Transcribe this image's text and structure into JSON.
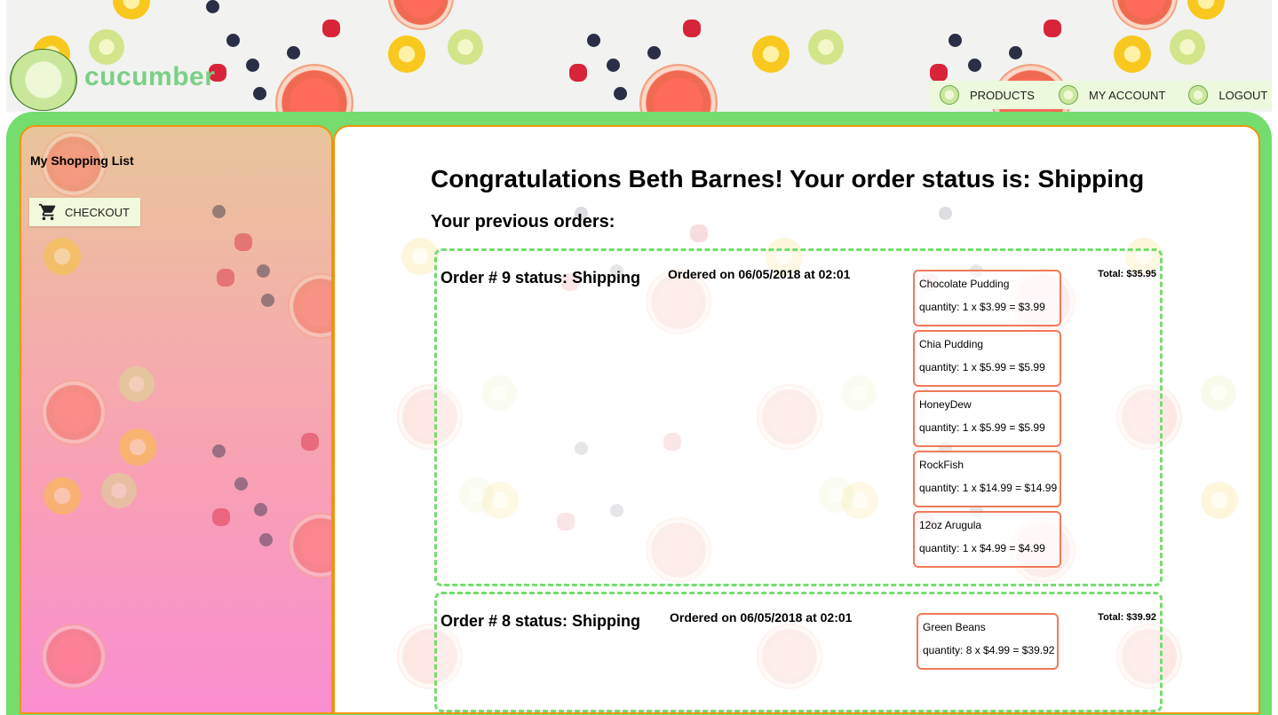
{
  "brand": {
    "name": "cucumber"
  },
  "nav": {
    "items": [
      {
        "label": "PRODUCTS",
        "icon": "cucumber-icon"
      },
      {
        "label": "MY ACCOUNT",
        "icon": "cucumber-icon"
      },
      {
        "label": "LOGOUT",
        "icon": "cucumber-icon"
      }
    ]
  },
  "sidebar": {
    "title": "My Shopping List",
    "checkout_label": "CHECKOUT",
    "checkout_icon": "cart-icon"
  },
  "main": {
    "heading": "Congratulations Beth Barnes! Your order status is: Shipping",
    "subheading": "Your previous orders:",
    "orders": [
      {
        "status": "Order # 9 status: Shipping",
        "date": "Ordered on 06/05/2018 at 02:01",
        "total": "Total: $35.95",
        "items": [
          {
            "name": "Chocolate Pudding",
            "qty": "quantity: 1 x $3.99 = $3.99"
          },
          {
            "name": "Chia Pudding",
            "qty": "quantity: 1 x $5.99 = $5.99"
          },
          {
            "name": "HoneyDew",
            "qty": "quantity: 1 x $5.99 = $5.99"
          },
          {
            "name": "RockFish",
            "qty": "quantity: 1 x $14.99 = $14.99"
          },
          {
            "name": "12oz Arugula",
            "qty": "quantity: 1 x $4.99 = $4.99"
          }
        ]
      },
      {
        "status": "Order # 8 status: Shipping",
        "date": "Ordered on 06/05/2018 at 02:01",
        "total": "Total: $39.92",
        "items": [
          {
            "name": "Green Beans",
            "qty": "quantity: 8 x $4.99 = $39.92"
          }
        ]
      }
    ]
  },
  "colors": {
    "frame_green": "#74dd6e",
    "border_orange": "#f0940f",
    "item_border": "#f07a5a",
    "nav_bg": "#edf9dc",
    "brand_text": "#7ccf86"
  }
}
